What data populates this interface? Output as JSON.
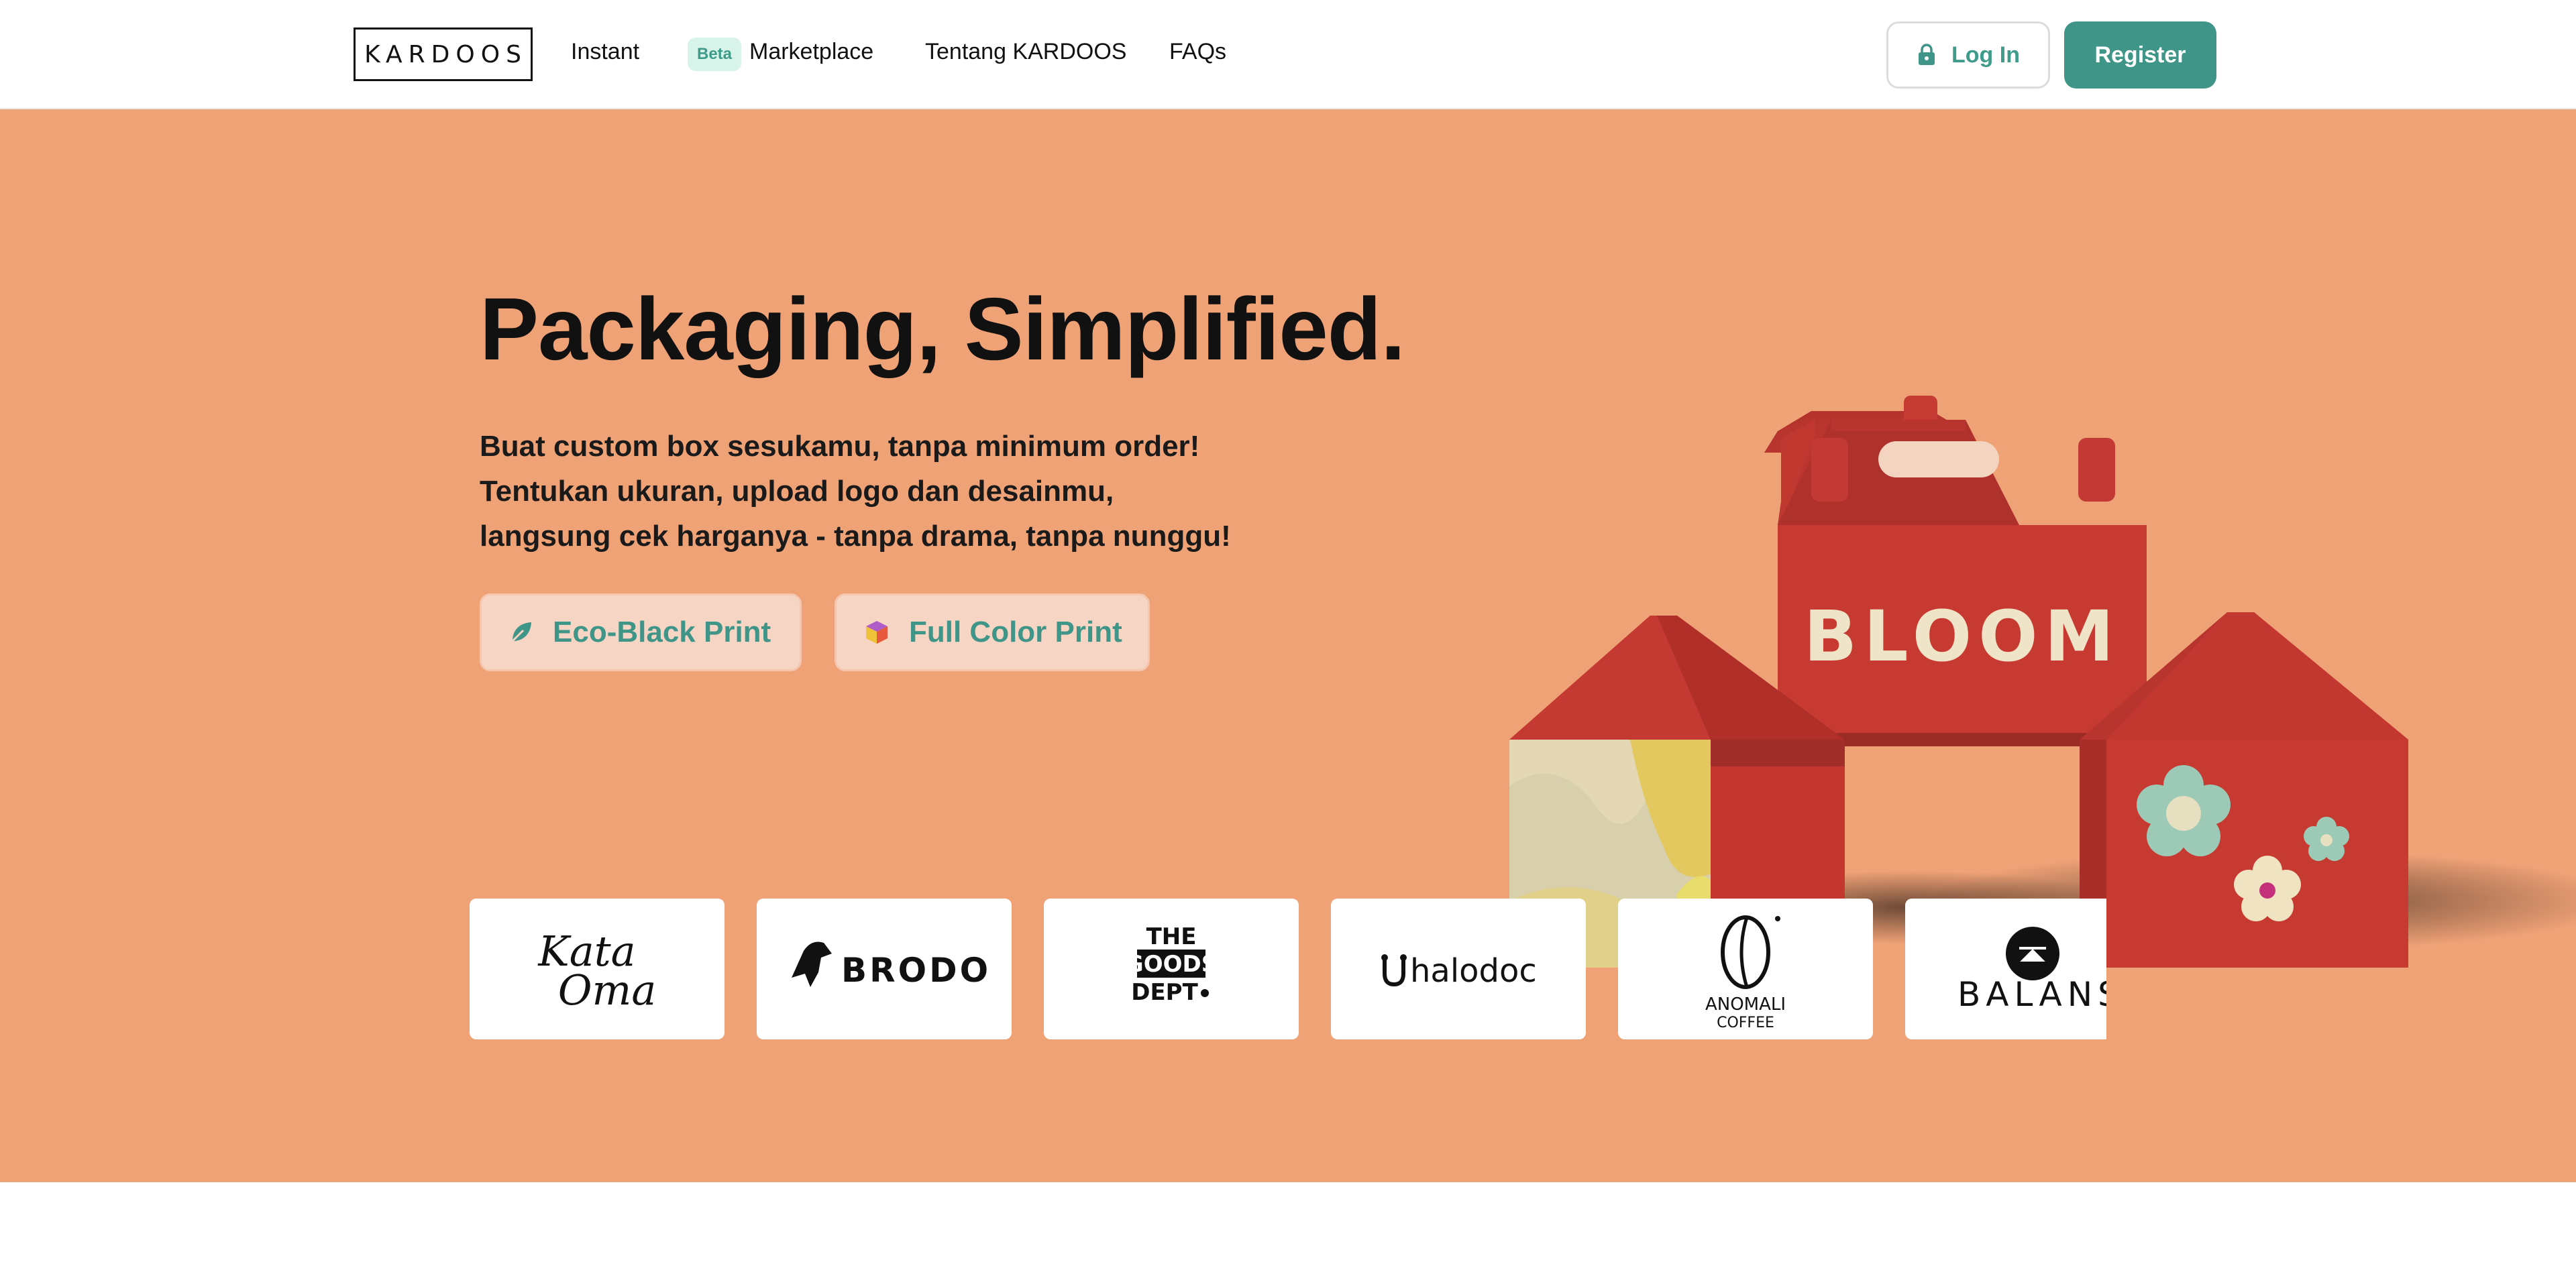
{
  "nav": {
    "logo": "KARDOOS",
    "links": {
      "instant": "Instant",
      "beta": "Beta",
      "marketplace": "Marketplace",
      "about": "Tentang KARDOOS",
      "faqs": "FAQs"
    },
    "login_label": "Log In",
    "register_label": "Register"
  },
  "hero": {
    "title": "Packaging, Simplified.",
    "description": [
      "Buat custom box sesukamu, tanpa minimum order!",
      "Tentukan ukuran, upload logo dan desainmu,",
      "langsung cek harganya - tanpa drama, tanpa nunggu!"
    ],
    "buttons": {
      "eco": "Eco-Black Print",
      "full": "Full Color Print"
    },
    "box_brand": "BLOOM"
  },
  "brands": {
    "kataoma": [
      "Kata",
      "Oma"
    ],
    "brodo": "BRODO",
    "goods": [
      "THE",
      "GOODS",
      "DEPT"
    ],
    "halodoc": "halodoc",
    "anomali": [
      "ANOMALI",
      "COFFEE"
    ],
    "balans": "BALANS"
  },
  "colors": {
    "hero_bg": "#f0a277",
    "accent": "#3f9588",
    "box_red": "#c73a32"
  }
}
